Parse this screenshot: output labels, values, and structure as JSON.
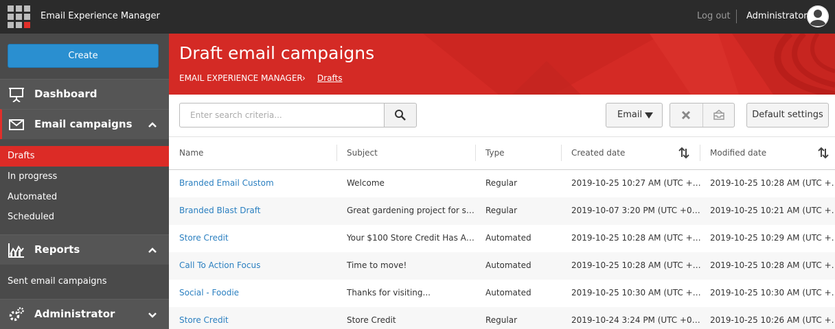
{
  "app": {
    "title": "Email Experience Manager",
    "logout_label": "Log out",
    "user_name": "Administrator"
  },
  "sidebar": {
    "create_label": "Create",
    "dashboard_label": "Dashboard",
    "email_campaigns_label": "Email campaigns",
    "email_items": [
      {
        "label": "Drafts",
        "active": true
      },
      {
        "label": "In progress"
      },
      {
        "label": "Automated"
      },
      {
        "label": "Scheduled"
      }
    ],
    "reports_label": "Reports",
    "report_items": [
      {
        "label": "Sent email campaigns"
      }
    ],
    "administrator_label": "Administrator"
  },
  "header": {
    "title": "Draft email campaigns",
    "breadcrumb_root": "EMAIL EXPERIENCE MANAGER",
    "breadcrumb_separator": "›",
    "breadcrumb_current": "Drafts"
  },
  "toolbar": {
    "search_placeholder": "Enter search criteria...",
    "filter_label": "Email",
    "default_settings_label": "Default settings"
  },
  "table": {
    "columns": [
      "Name",
      "Subject",
      "Type",
      "Created date",
      "Modified date"
    ],
    "rows": [
      {
        "name": "Branded Email Custom",
        "subject": "Welcome",
        "type": "Regular",
        "created": "2019-10-25 10:27 AM (UTC +…",
        "modified": "2019-10-25 10:28 AM (UTC +…"
      },
      {
        "name": "Branded Blast Draft",
        "subject": "Great gardening project for s…",
        "type": "Regular",
        "created": "2019-10-07 3:20 PM (UTC +0…",
        "modified": "2019-10-25 10:21 AM (UTC +…"
      },
      {
        "name": "Store Credit",
        "subject": "Your $100 Store Credit Has A…",
        "type": "Automated",
        "created": "2019-10-25 10:28 AM (UTC +…",
        "modified": "2019-10-25 10:29 AM (UTC +…"
      },
      {
        "name": "Call To Action Focus",
        "subject": "Time to move!",
        "type": "Automated",
        "created": "2019-10-25 10:28 AM (UTC +…",
        "modified": "2019-10-25 10:28 AM (UTC +…"
      },
      {
        "name": "Social - Foodie",
        "subject": "Thanks for visiting...",
        "type": "Automated",
        "created": "2019-10-25 10:30 AM (UTC +…",
        "modified": "2019-10-25 10:30 AM (UTC +…"
      },
      {
        "name": "Store Credit",
        "subject": "Store Credit",
        "type": "Regular",
        "created": "2019-10-24 3:24 PM (UTC +0…",
        "modified": "2019-10-25 10:26 AM (UTC +…"
      }
    ]
  },
  "colors": {
    "accent_red": "#d42a25",
    "create_blue": "#2a8fd0",
    "link_blue": "#2a7fc0",
    "topbar": "#2b2b2b",
    "sidebar": "#4a4a4a"
  },
  "icons": [
    "grid-logo-icon",
    "user-avatar-icon",
    "dashboard-icon",
    "envelope-icon",
    "chevron-up-icon",
    "reports-chart-icon",
    "gear-icon",
    "chevron-down-icon",
    "search-icon",
    "caret-down-icon",
    "delete-x-icon",
    "send-tray-icon",
    "sort-icon"
  ]
}
